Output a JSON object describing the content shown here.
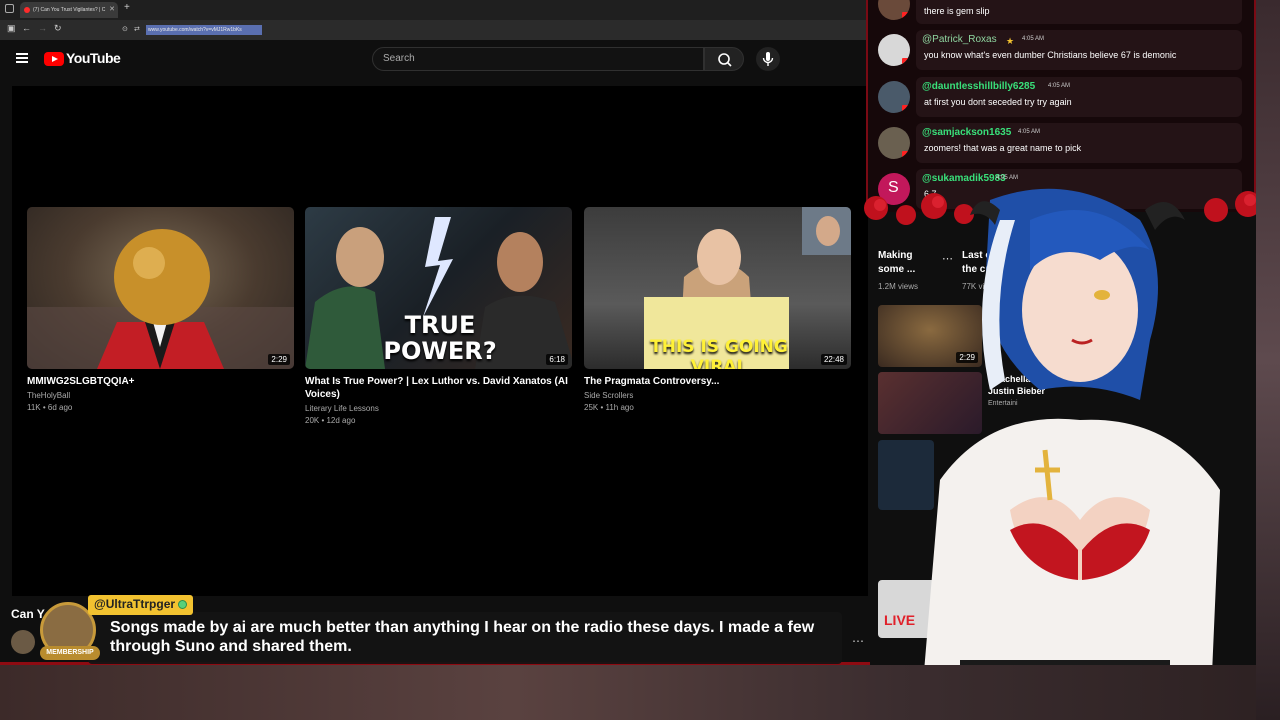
{
  "browser": {
    "tab_title": "(7) Can You Trust Vigilantes? | C",
    "url": "www.youtube.com/watch?v=vMJ1Rw1bKs"
  },
  "youtube": {
    "brand": "YouTube",
    "search_placeholder": "Search"
  },
  "end_screen_videos": [
    {
      "title": "MMIWG2SLGBTQQIA+",
      "channel": "TheHolyBall",
      "meta": "11K • 6d ago",
      "duration": "2:29",
      "thumb_text": ""
    },
    {
      "title": "What Is True Power? | Lex Luthor vs. David Xanatos (AI Voices)",
      "channel": "Literary Life Lessons",
      "meta": "20K • 12d ago",
      "duration": "6:18",
      "thumb_text": "TRUE POWER?"
    },
    {
      "title": "The Pragmata Controversy...",
      "channel": "Side Scrollers",
      "meta": "25K • 11h ago",
      "duration": "22:48",
      "thumb_text": "THIS IS GOING VIRAL"
    }
  ],
  "below_player": {
    "title": "Can Y"
  },
  "chat": [
    {
      "user": "",
      "time": "",
      "text": "there is gem slip"
    },
    {
      "user": "@Patrick_Roxas",
      "time": "4:05 AM",
      "text": "you know what's even dumber Christians believe 67 is demonic"
    },
    {
      "user": "@dauntlesshillbilly6285",
      "time": "4:05 AM",
      "text": "at first you dont seceded try try again"
    },
    {
      "user": "@samjackson1635",
      "time": "4:05 AM",
      "text": "zoomers! that was a great name to pick"
    },
    {
      "user": "@sukamadik5983",
      "time": "4:05 AM",
      "text": "6 7"
    }
  ],
  "sidebar": {
    "items": [
      {
        "title_line1": "Making",
        "title_line2": "some ...",
        "views": "1.2M views"
      },
      {
        "title_line1": "Last c",
        "title_line2": "the cute",
        "views": "77K views"
      }
    ],
    "list": [
      {
        "duration": "2:29",
        "title": "M"
      },
      {
        "title": "Coachella 2026",
        "subtitle": "Justin Bieber",
        "meta": "Entertaini"
      }
    ],
    "live_label": "LIVE"
  },
  "highlight": {
    "username": "@UltraTtrpger",
    "badge": "MEMBERSHIP",
    "message": "Songs made by ai are much better than anything I hear on the radio these days. I made a few through Suno and shared them."
  }
}
